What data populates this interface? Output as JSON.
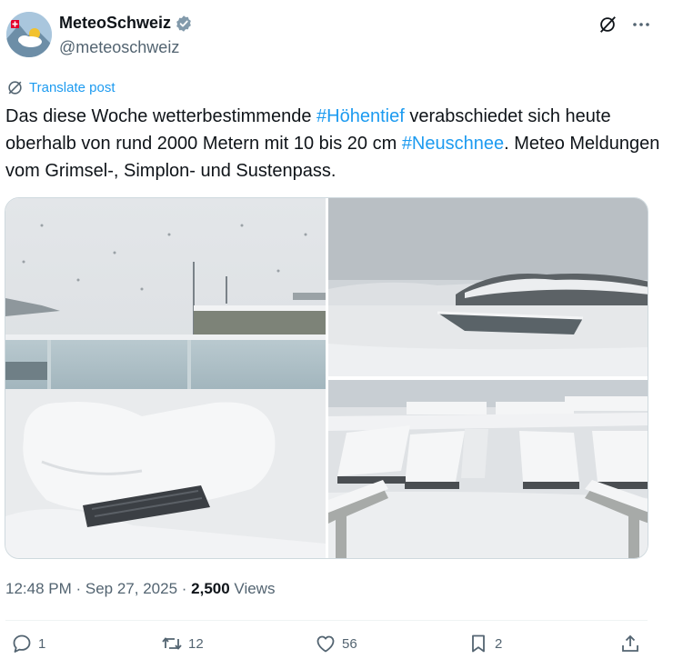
{
  "author": {
    "display_name": "MeteoSchweiz",
    "handle": "@meteoschweiz",
    "avatar_icon": "meteoschweiz-logo-icon",
    "verified_icon": "verified-badge-icon"
  },
  "translate": {
    "label": "Translate post",
    "icon": "globe-icon"
  },
  "post": {
    "part1": "Das diese Woche wetterbestimmende ",
    "tag1": "#Höhentief",
    "part2": " verabschiedet sich heute oberhalb von rund 2000 Metern mit 10 bis 20 cm ",
    "tag2": "#Neuschnee",
    "part3": ". Meteo Meldungen vom Grimsel-, Simplon- und Sustenpass."
  },
  "meta": {
    "time": "12:48 PM",
    "sep1": " · ",
    "date": "Sep 27, 2025",
    "sep2": " · ",
    "views_count": "2,500",
    "views_label": " Views"
  },
  "actions": {
    "reply": {
      "icon": "reply-icon",
      "count": "1"
    },
    "repost": {
      "icon": "repost-icon",
      "count": "12"
    },
    "like": {
      "icon": "heart-icon",
      "count": "56"
    },
    "bookmark": {
      "icon": "bookmark-icon",
      "count": "2"
    },
    "share": {
      "icon": "share-icon"
    }
  },
  "colors": {
    "link": "#1d9bf0",
    "secondary_text": "#536471",
    "primary_text": "#0f1419"
  }
}
